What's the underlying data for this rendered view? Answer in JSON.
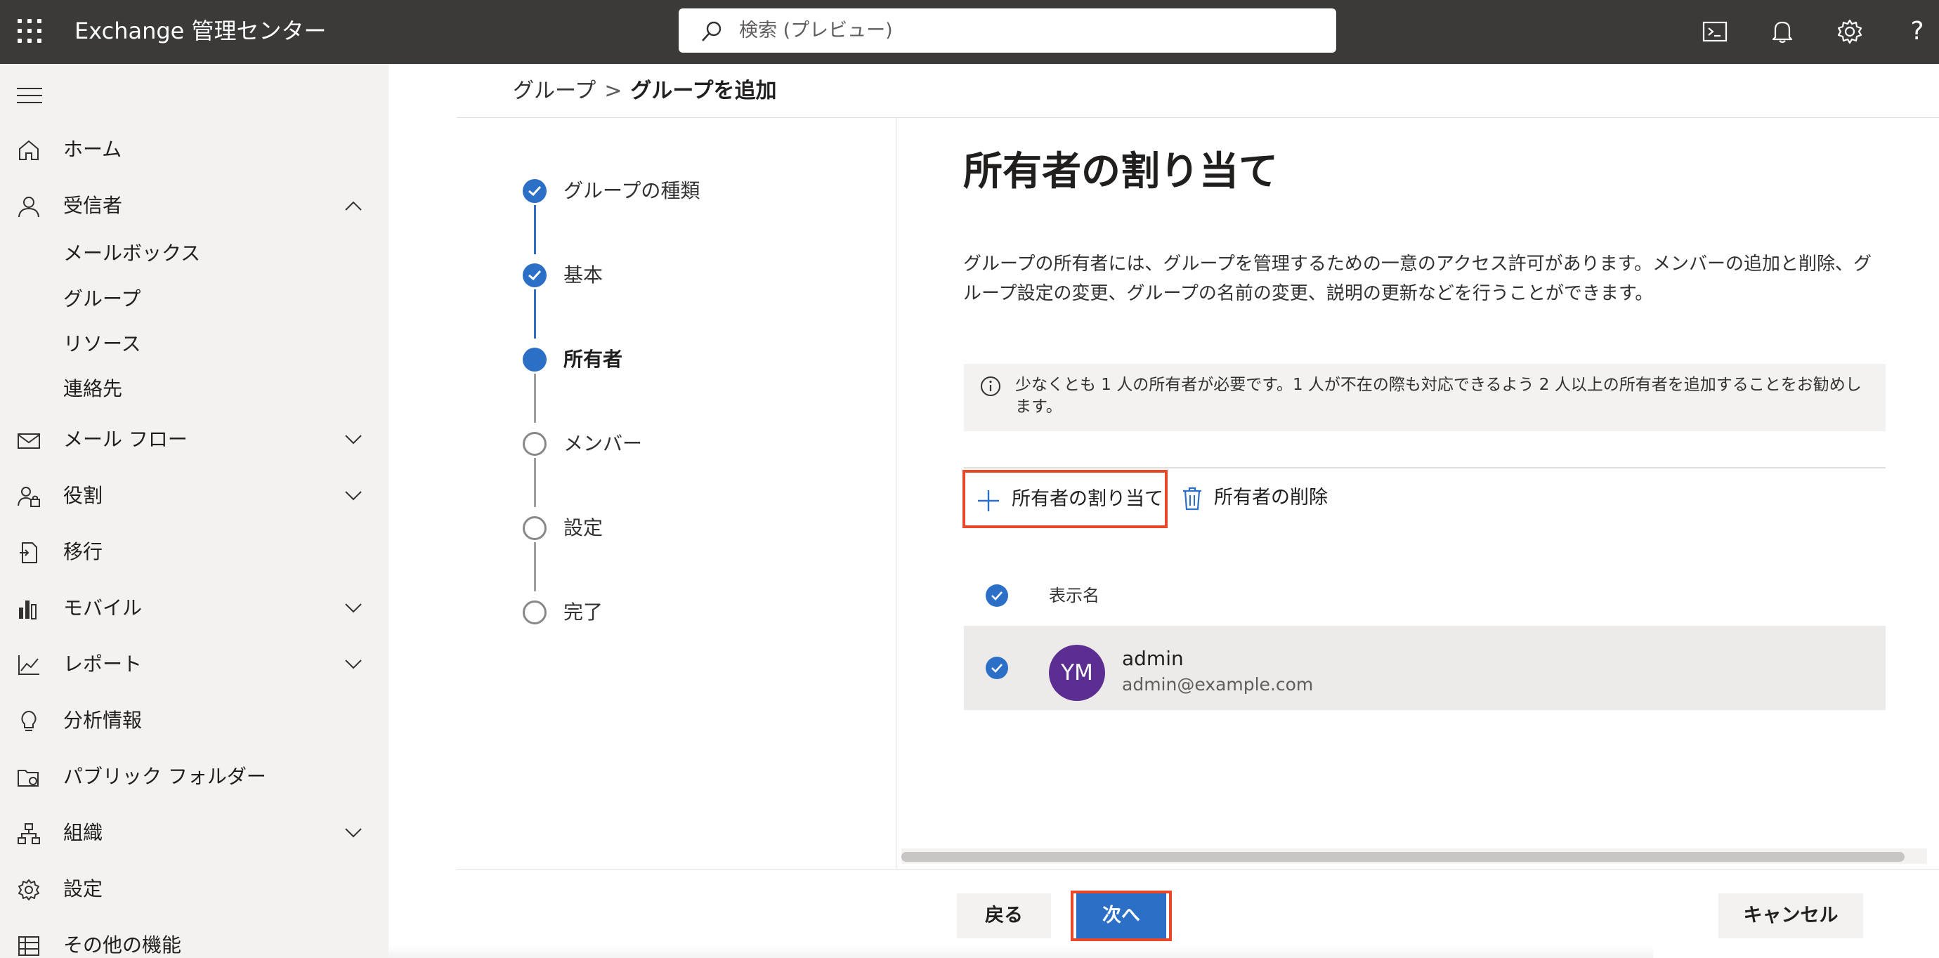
{
  "app": {
    "title": "Exchange 管理センター"
  },
  "search": {
    "placeholder": "検索 (プレビュー)"
  },
  "topbar": {
    "icons": [
      "terminal-icon",
      "bell-icon",
      "gear-icon",
      "help-icon"
    ],
    "help_glyph": "?"
  },
  "sidebar": {
    "items": [
      {
        "label": "ホーム",
        "icon": "home-icon"
      },
      {
        "label": "受信者",
        "icon": "person-icon",
        "expanded": true,
        "children": [
          "メールボックス",
          "グループ",
          "リソース",
          "連絡先"
        ]
      },
      {
        "label": "メール フロー",
        "icon": "mail-icon"
      },
      {
        "label": "役割",
        "icon": "roles-icon"
      },
      {
        "label": "移行",
        "icon": "migration-icon"
      },
      {
        "label": "モバイル",
        "icon": "mobile-icon"
      },
      {
        "label": "レポート",
        "icon": "report-icon"
      },
      {
        "label": "分析情報",
        "icon": "lightbulb-icon"
      },
      {
        "label": "パブリック フォルダー",
        "icon": "public-folder-icon"
      },
      {
        "label": "組織",
        "icon": "org-icon"
      },
      {
        "label": "設定",
        "icon": "settings-icon"
      },
      {
        "label": "その他の機能",
        "icon": "table-icon"
      }
    ]
  },
  "breadcrumb": {
    "parent": "グループ",
    "separator": ">",
    "current": "グループを追加"
  },
  "steps": [
    {
      "label": "グループの種類",
      "state": "done"
    },
    {
      "label": "基本",
      "state": "done"
    },
    {
      "label": "所有者",
      "state": "current"
    },
    {
      "label": "メンバー",
      "state": "todo"
    },
    {
      "label": "設定",
      "state": "todo"
    },
    {
      "label": "完了",
      "state": "todo"
    }
  ],
  "panel": {
    "title": "所有者の割り当て",
    "description": "グループの所有者には、グループを管理するための一意のアクセス許可があります。メンバーの追加と削除、グループ設定の変更、グループの名前の変更、説明の更新などを行うことができます。",
    "info": "少なくとも 1 人の所有者が必要です。1 人が不在の際も対応できるよう 2 人以上の所有者を追加することをお勧めします。",
    "commands": {
      "assign": "所有者の割り当て",
      "remove": "所有者の削除"
    },
    "table": {
      "column": "表示名",
      "rows": [
        {
          "initials": "YM",
          "name": "admin",
          "email": "admin@example.com",
          "selected": true
        }
      ]
    }
  },
  "footer": {
    "back": "戻る",
    "next": "次へ",
    "cancel": "キャンセル"
  },
  "colors": {
    "topbar": "#3b3a39",
    "accent": "#2b6fc7",
    "highlight": "#e8472a",
    "avatar": "#5c2e91"
  }
}
